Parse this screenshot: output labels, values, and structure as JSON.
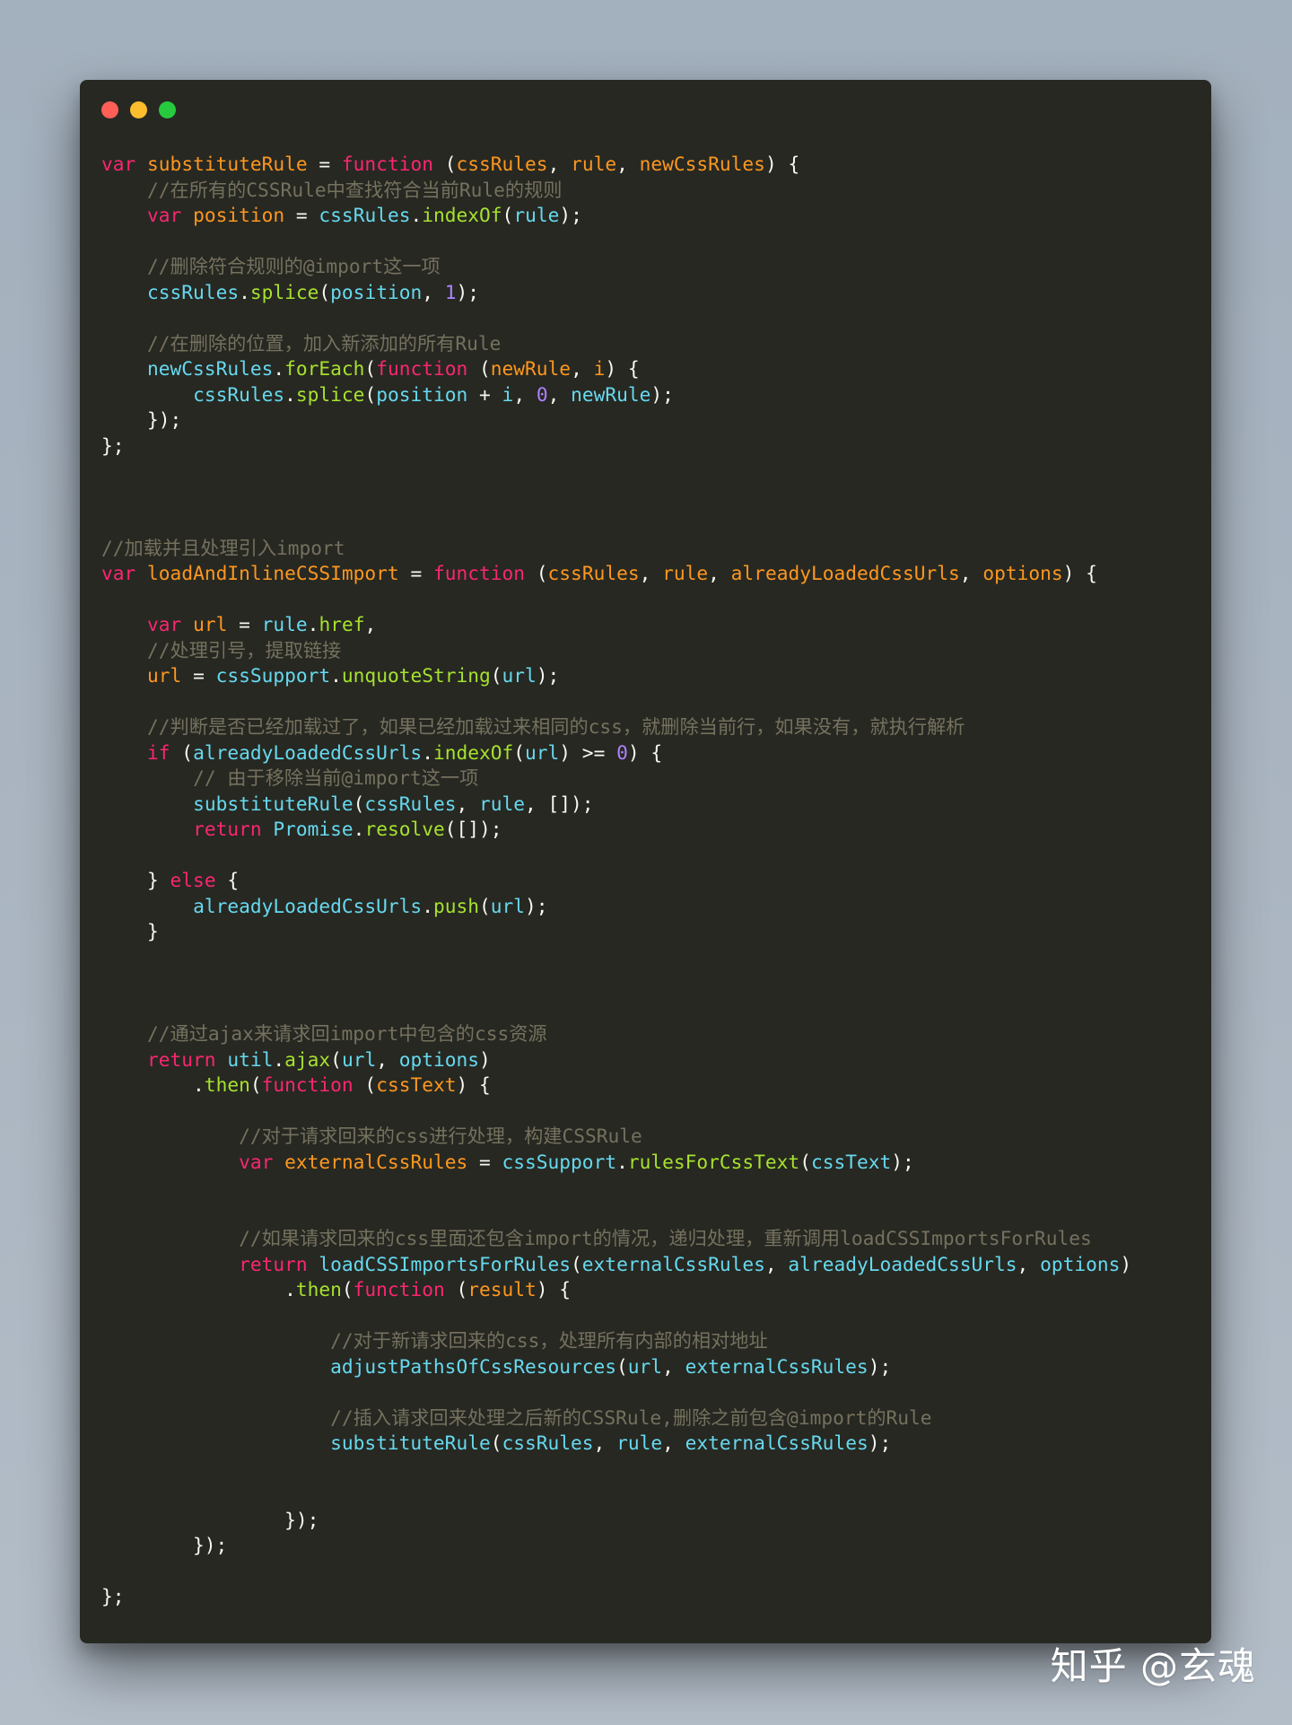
{
  "window": {
    "traffic_lights": [
      {
        "name": "close",
        "color": "#ff5f56"
      },
      {
        "name": "minimize",
        "color": "#ffbd2e"
      },
      {
        "name": "maximize",
        "color": "#27c93f"
      }
    ]
  },
  "theme": {
    "background": "#272822",
    "keyword": "#f92672",
    "function_call": "#a6e22e",
    "declared_name": "#fd971f",
    "identifier": "#66d9ef",
    "number": "#ae81ff",
    "comment": "#75715e",
    "plain": "#f8f8f2"
  },
  "code_lines": [
    [
      [
        "kw",
        "var"
      ],
      [
        "pl",
        " "
      ],
      [
        "var",
        "substituteRule"
      ],
      [
        "pl",
        " = "
      ],
      [
        "kw",
        "function"
      ],
      [
        "pl",
        " ("
      ],
      [
        "var",
        "cssRules"
      ],
      [
        "pl",
        ", "
      ],
      [
        "var",
        "rule"
      ],
      [
        "pl",
        ", "
      ],
      [
        "var",
        "newCssRules"
      ],
      [
        "pl",
        ") {"
      ]
    ],
    [
      [
        "pl",
        "    "
      ],
      [
        "cm",
        "//在所有的CSSRule中查找符合当前Rule的规则"
      ]
    ],
    [
      [
        "pl",
        "    "
      ],
      [
        "kw",
        "var"
      ],
      [
        "pl",
        " "
      ],
      [
        "var",
        "position"
      ],
      [
        "pl",
        " = "
      ],
      [
        "id",
        "cssRules"
      ],
      [
        "pl",
        "."
      ],
      [
        "fn",
        "indexOf"
      ],
      [
        "pl",
        "("
      ],
      [
        "id",
        "rule"
      ],
      [
        "pl",
        ");"
      ]
    ],
    [],
    [
      [
        "pl",
        "    "
      ],
      [
        "cm",
        "//删除符合规则的@import这一项"
      ]
    ],
    [
      [
        "pl",
        "    "
      ],
      [
        "id",
        "cssRules"
      ],
      [
        "pl",
        "."
      ],
      [
        "fn",
        "splice"
      ],
      [
        "pl",
        "("
      ],
      [
        "id",
        "position"
      ],
      [
        "pl",
        ", "
      ],
      [
        "num",
        "1"
      ],
      [
        "pl",
        ");"
      ]
    ],
    [],
    [
      [
        "pl",
        "    "
      ],
      [
        "cm",
        "//在删除的位置，加入新添加的所有Rule"
      ]
    ],
    [
      [
        "pl",
        "    "
      ],
      [
        "id",
        "newCssRules"
      ],
      [
        "pl",
        "."
      ],
      [
        "fn",
        "forEach"
      ],
      [
        "pl",
        "("
      ],
      [
        "kw",
        "function"
      ],
      [
        "pl",
        " ("
      ],
      [
        "var",
        "newRule"
      ],
      [
        "pl",
        ", "
      ],
      [
        "var",
        "i"
      ],
      [
        "pl",
        ") {"
      ]
    ],
    [
      [
        "pl",
        "        "
      ],
      [
        "id",
        "cssRules"
      ],
      [
        "pl",
        "."
      ],
      [
        "fn",
        "splice"
      ],
      [
        "pl",
        "("
      ],
      [
        "id",
        "position"
      ],
      [
        "pl",
        " + "
      ],
      [
        "id",
        "i"
      ],
      [
        "pl",
        ", "
      ],
      [
        "num",
        "0"
      ],
      [
        "pl",
        ", "
      ],
      [
        "id",
        "newRule"
      ],
      [
        "pl",
        ");"
      ]
    ],
    [
      [
        "pl",
        "    });"
      ]
    ],
    [
      [
        "pl",
        "};"
      ]
    ],
    [],
    [],
    [],
    [
      [
        "cm",
        "//加载并且处理引入import"
      ]
    ],
    [
      [
        "kw",
        "var"
      ],
      [
        "pl",
        " "
      ],
      [
        "var",
        "loadAndInlineCSSImport"
      ],
      [
        "pl",
        " = "
      ],
      [
        "kw",
        "function"
      ],
      [
        "pl",
        " ("
      ],
      [
        "var",
        "cssRules"
      ],
      [
        "pl",
        ", "
      ],
      [
        "var",
        "rule"
      ],
      [
        "pl",
        ", "
      ],
      [
        "var",
        "alreadyLoadedCssUrls"
      ],
      [
        "pl",
        ", "
      ],
      [
        "var",
        "options"
      ],
      [
        "pl",
        ") {"
      ]
    ],
    [],
    [
      [
        "pl",
        "    "
      ],
      [
        "kw",
        "var"
      ],
      [
        "pl",
        " "
      ],
      [
        "var",
        "url"
      ],
      [
        "pl",
        " = "
      ],
      [
        "id",
        "rule"
      ],
      [
        "pl",
        "."
      ],
      [
        "fn",
        "href"
      ],
      [
        "pl",
        ","
      ]
    ],
    [
      [
        "pl",
        "    "
      ],
      [
        "cm",
        "//处理引号，提取链接"
      ]
    ],
    [
      [
        "pl",
        "    "
      ],
      [
        "var",
        "url"
      ],
      [
        "pl",
        " = "
      ],
      [
        "id",
        "cssSupport"
      ],
      [
        "pl",
        "."
      ],
      [
        "fn",
        "unquoteString"
      ],
      [
        "pl",
        "("
      ],
      [
        "id",
        "url"
      ],
      [
        "pl",
        ");"
      ]
    ],
    [],
    [
      [
        "pl",
        "    "
      ],
      [
        "cm",
        "//判断是否已经加载过了，如果已经加载过来相同的css，就删除当前行，如果没有，就执行解析"
      ]
    ],
    [
      [
        "pl",
        "    "
      ],
      [
        "kw",
        "if"
      ],
      [
        "pl",
        " ("
      ],
      [
        "id",
        "alreadyLoadedCssUrls"
      ],
      [
        "pl",
        "."
      ],
      [
        "fn",
        "indexOf"
      ],
      [
        "pl",
        "("
      ],
      [
        "id",
        "url"
      ],
      [
        "pl",
        ") >= "
      ],
      [
        "num",
        "0"
      ],
      [
        "pl",
        ") {"
      ]
    ],
    [
      [
        "pl",
        "        "
      ],
      [
        "cm",
        "// 由于移除当前@import这一项"
      ]
    ],
    [
      [
        "pl",
        "        "
      ],
      [
        "id",
        "substituteRule"
      ],
      [
        "pl",
        "("
      ],
      [
        "id",
        "cssRules"
      ],
      [
        "pl",
        ", "
      ],
      [
        "id",
        "rule"
      ],
      [
        "pl",
        ", []);"
      ]
    ],
    [
      [
        "pl",
        "        "
      ],
      [
        "kw",
        "return"
      ],
      [
        "pl",
        " "
      ],
      [
        "id",
        "Promise"
      ],
      [
        "pl",
        "."
      ],
      [
        "fn",
        "resolve"
      ],
      [
        "pl",
        "([]);"
      ]
    ],
    [],
    [
      [
        "pl",
        "    } "
      ],
      [
        "kw",
        "else"
      ],
      [
        "pl",
        " {"
      ]
    ],
    [
      [
        "pl",
        "        "
      ],
      [
        "id",
        "alreadyLoadedCssUrls"
      ],
      [
        "pl",
        "."
      ],
      [
        "fn",
        "push"
      ],
      [
        "pl",
        "("
      ],
      [
        "id",
        "url"
      ],
      [
        "pl",
        ");"
      ]
    ],
    [
      [
        "pl",
        "    }"
      ]
    ],
    [],
    [],
    [],
    [
      [
        "pl",
        "    "
      ],
      [
        "cm",
        "//通过ajax来请求回import中包含的css资源"
      ]
    ],
    [
      [
        "pl",
        "    "
      ],
      [
        "kw",
        "return"
      ],
      [
        "pl",
        " "
      ],
      [
        "id",
        "util"
      ],
      [
        "pl",
        "."
      ],
      [
        "fn",
        "ajax"
      ],
      [
        "pl",
        "("
      ],
      [
        "id",
        "url"
      ],
      [
        "pl",
        ", "
      ],
      [
        "id",
        "options"
      ],
      [
        "pl",
        ")"
      ]
    ],
    [
      [
        "pl",
        "        ."
      ],
      [
        "fn",
        "then"
      ],
      [
        "pl",
        "("
      ],
      [
        "kw",
        "function"
      ],
      [
        "pl",
        " ("
      ],
      [
        "var",
        "cssText"
      ],
      [
        "pl",
        ") {"
      ]
    ],
    [],
    [
      [
        "pl",
        "            "
      ],
      [
        "cm",
        "//对于请求回来的css进行处理，构建CSSRule"
      ]
    ],
    [
      [
        "pl",
        "            "
      ],
      [
        "kw",
        "var"
      ],
      [
        "pl",
        " "
      ],
      [
        "var",
        "externalCssRules"
      ],
      [
        "pl",
        " = "
      ],
      [
        "id",
        "cssSupport"
      ],
      [
        "pl",
        "."
      ],
      [
        "fn",
        "rulesForCssText"
      ],
      [
        "pl",
        "("
      ],
      [
        "id",
        "cssText"
      ],
      [
        "pl",
        ");"
      ]
    ],
    [],
    [],
    [
      [
        "pl",
        "            "
      ],
      [
        "cm",
        "//如果请求回来的css里面还包含import的情况，递归处理，重新调用loadCSSImportsForRules"
      ]
    ],
    [
      [
        "pl",
        "            "
      ],
      [
        "kw",
        "return"
      ],
      [
        "pl",
        " "
      ],
      [
        "id",
        "loadCSSImportsForRules"
      ],
      [
        "pl",
        "("
      ],
      [
        "id",
        "externalCssRules"
      ],
      [
        "pl",
        ", "
      ],
      [
        "id",
        "alreadyLoadedCssUrls"
      ],
      [
        "pl",
        ", "
      ],
      [
        "id",
        "options"
      ],
      [
        "pl",
        ")"
      ]
    ],
    [
      [
        "pl",
        "                ."
      ],
      [
        "fn",
        "then"
      ],
      [
        "pl",
        "("
      ],
      [
        "kw",
        "function"
      ],
      [
        "pl",
        " ("
      ],
      [
        "var",
        "result"
      ],
      [
        "pl",
        ") {"
      ]
    ],
    [],
    [
      [
        "pl",
        "                    "
      ],
      [
        "cm",
        "//对于新请求回来的css，处理所有内部的相对地址"
      ]
    ],
    [
      [
        "pl",
        "                    "
      ],
      [
        "id",
        "adjustPathsOfCssResources"
      ],
      [
        "pl",
        "("
      ],
      [
        "id",
        "url"
      ],
      [
        "pl",
        ", "
      ],
      [
        "id",
        "externalCssRules"
      ],
      [
        "pl",
        ");"
      ]
    ],
    [],
    [
      [
        "pl",
        "                    "
      ],
      [
        "cm",
        "//插入请求回来处理之后新的CSSRule,删除之前包含@import的Rule"
      ]
    ],
    [
      [
        "pl",
        "                    "
      ],
      [
        "id",
        "substituteRule"
      ],
      [
        "pl",
        "("
      ],
      [
        "id",
        "cssRules"
      ],
      [
        "pl",
        ", "
      ],
      [
        "id",
        "rule"
      ],
      [
        "pl",
        ", "
      ],
      [
        "id",
        "externalCssRules"
      ],
      [
        "pl",
        ");"
      ]
    ],
    [],
    [],
    [
      [
        "pl",
        "                });"
      ]
    ],
    [
      [
        "pl",
        "        });"
      ]
    ],
    [],
    [
      [
        "pl",
        "};"
      ]
    ]
  ],
  "watermark": "知乎 @玄魂"
}
